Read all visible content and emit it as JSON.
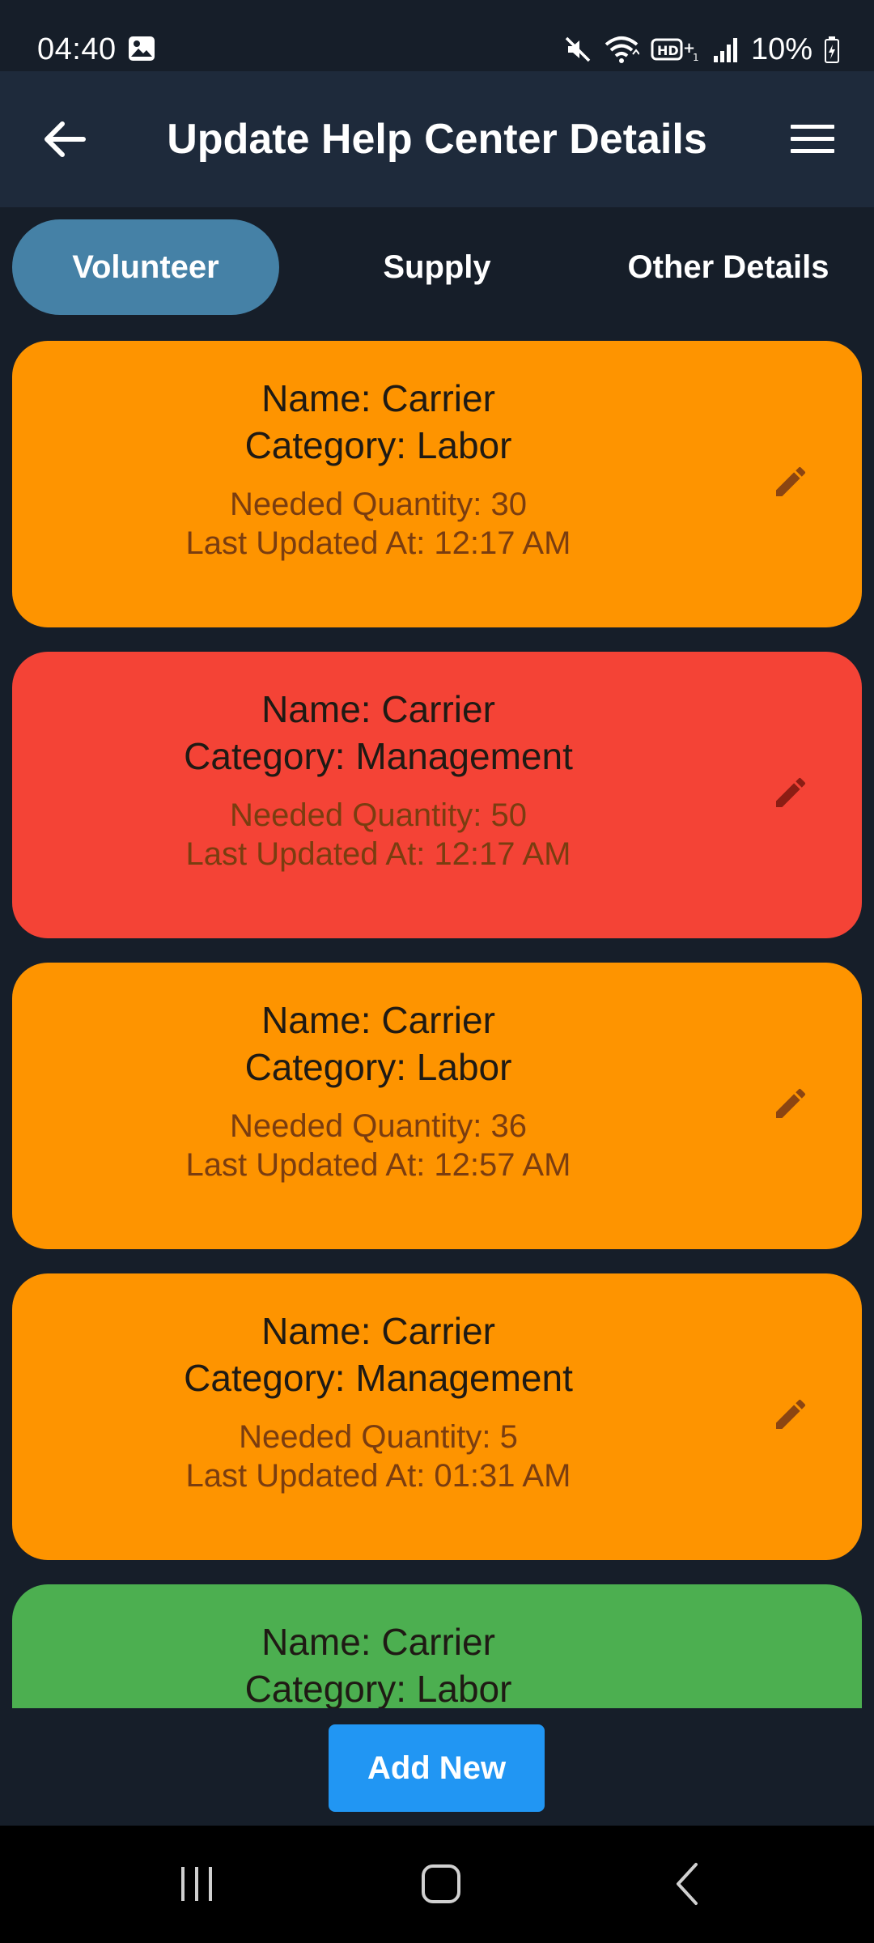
{
  "status_bar": {
    "time": "04:40",
    "battery": "10%",
    "icons": [
      "image-icon",
      "mute-icon",
      "wifi-icon",
      "hd-voice-icon",
      "signal-icon",
      "battery-icon"
    ]
  },
  "app_bar": {
    "title": "Update Help Center Details",
    "back_icon": "arrow-left-icon",
    "menu_icon": "hamburger-menu-icon"
  },
  "tabs": [
    {
      "label": "Volunteer",
      "active": true
    },
    {
      "label": "Supply",
      "active": false
    },
    {
      "label": "Other Details",
      "active": false
    }
  ],
  "cards": [
    {
      "name": "Name: Carrier",
      "category": "Category: Labor",
      "quantity": "Needed Quantity: 30",
      "updated": "Last Updated At: 12:17 AM",
      "color": "#fe9400"
    },
    {
      "name": "Name: Carrier",
      "category": "Category: Management",
      "quantity": "Needed Quantity: 50",
      "updated": "Last Updated At: 12:17 AM",
      "color": "#f44336"
    },
    {
      "name": "Name: Carrier",
      "category": "Category: Labor",
      "quantity": "Needed Quantity: 36",
      "updated": "Last Updated At: 12:57 AM",
      "color": "#fe9400"
    },
    {
      "name": "Name: Carrier",
      "category": "Category: Management",
      "quantity": "Needed Quantity: 5",
      "updated": "Last Updated At: 01:31 AM",
      "color": "#fe9400"
    },
    {
      "name": "Name: Carrier",
      "category": "Category: Labor",
      "quantity": "",
      "updated": "",
      "color": "#4caf50"
    }
  ],
  "add_button": {
    "label": "Add New",
    "color": "#2196f3"
  },
  "nav_bar": {
    "icons": [
      "recents-icon",
      "home-icon",
      "back-icon"
    ]
  }
}
